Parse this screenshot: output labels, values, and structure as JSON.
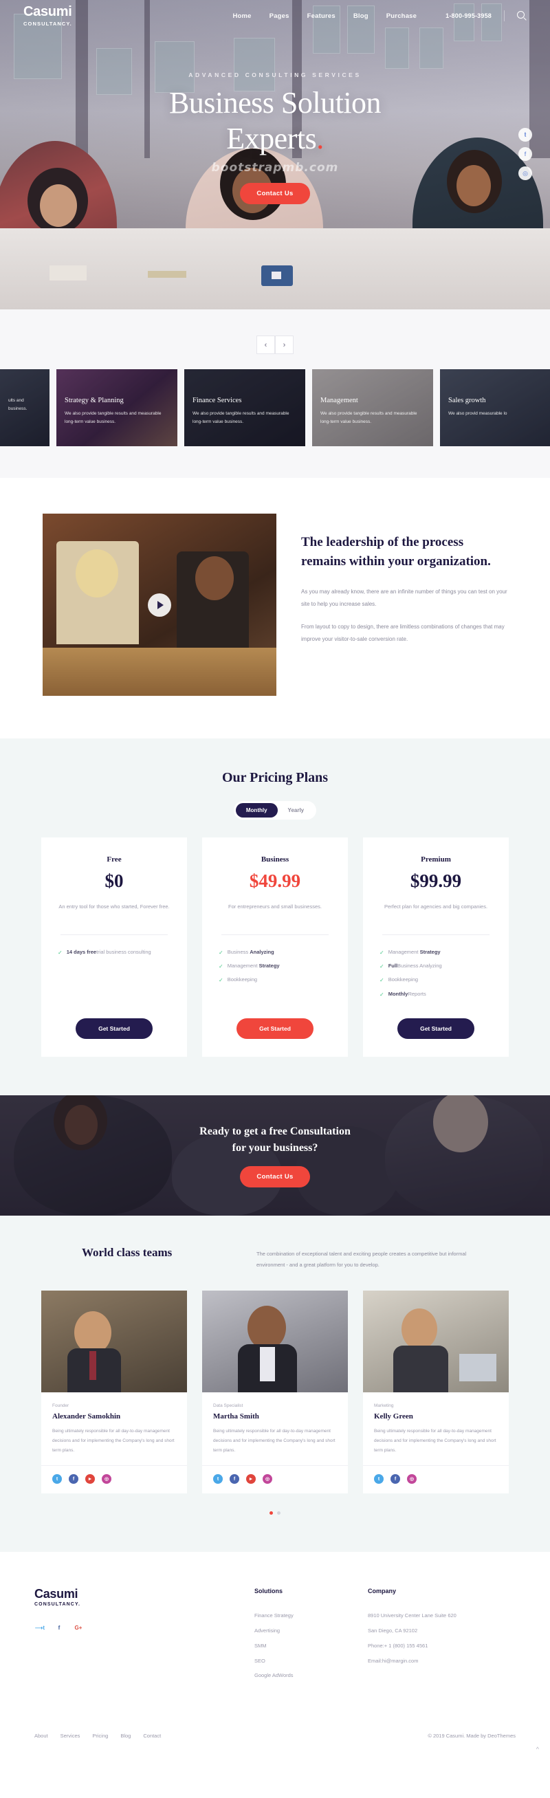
{
  "header": {
    "logo": "Casumi",
    "logo_sub": "CONSULTANCY.",
    "nav": [
      {
        "label": "Home"
      },
      {
        "label": "Pages"
      },
      {
        "label": "Features"
      },
      {
        "label": "Blog"
      },
      {
        "label": "Purchase"
      }
    ],
    "phone": "1-800-995-3958",
    "search_icon": "search-icon"
  },
  "hero": {
    "eyebrow": "ADVANCED CONSULTING SERVICES",
    "title_line1": "Business Solution",
    "title_line2": "Experts",
    "title_dot": ".",
    "watermark": "bootstrapmb.com",
    "cta": "Contact Us",
    "side_dots": [
      "●",
      "●",
      "●"
    ]
  },
  "services": {
    "prev_icon": "chevron-left-icon",
    "next_icon": "chevron-right-icon",
    "cards": [
      {
        "title": "",
        "text": "ults and\nbusiness."
      },
      {
        "title": "Strategy & Planning",
        "text": "We also provide tangible results and measurable long-term value business."
      },
      {
        "title": "Finance Services",
        "text": "We also provide tangible results and measurable long-term value business."
      },
      {
        "title": "Management",
        "text": "We also provide tangible results and measurable long-term value business."
      },
      {
        "title": "Sales growth",
        "text": "We also provid measurable lo"
      }
    ]
  },
  "leadership": {
    "play_icon": "play-icon",
    "heading": "The leadership of the process remains within your organization.",
    "para1": "As you may already know, there are an infinite number of things you can test on your site to help you increase sales.",
    "para2": "From layout to copy to design, there are limitless combinations of changes that may improve your visitor-to-sale conversion rate."
  },
  "pricing": {
    "heading": "Our Pricing Plans",
    "toggle_monthly": "Monthly",
    "toggle_yearly": "Yearly",
    "plans": [
      {
        "name": "Free",
        "price": "$0",
        "desc": "An entry tool for those who started, Forever free.",
        "features": [
          {
            "bold": "14 days free",
            "rest": "trial business consulting"
          }
        ],
        "button": "Get Started",
        "accent": "dark"
      },
      {
        "name": "Business",
        "price": "$49.99",
        "desc": "For entrepreneurs and small businesses.",
        "features": [
          {
            "bold": "",
            "rest": "Business ",
            "tail_bold": "Analyzing"
          },
          {
            "bold": "",
            "rest": "Management ",
            "tail_bold": "Strategy"
          },
          {
            "bold": "",
            "rest": "Bookkeeping",
            "tail_bold": ""
          }
        ],
        "button": "Get Started",
        "accent": "red"
      },
      {
        "name": "Premium",
        "price": "$99.99",
        "desc": "Perfect plan for agencies and big companies.",
        "features": [
          {
            "bold": "",
            "rest": "Management ",
            "tail_bold": "Strategy"
          },
          {
            "bold": "Full",
            "rest": "Business Analyzing",
            "tail_bold": ""
          },
          {
            "bold": "",
            "rest": "Bookkeeping",
            "tail_bold": ""
          },
          {
            "bold": "Monthly",
            "rest": "Reports",
            "tail_bold": ""
          }
        ],
        "button": "Get Started",
        "accent": "dark"
      }
    ]
  },
  "consultation": {
    "line1": "Ready to get a free Consultation",
    "line2": "for your business?",
    "cta": "Contact Us"
  },
  "team": {
    "heading": "World class teams",
    "intro": "The combination of exceptional talent and exciting people creates a competitive but informal environment - and a great platform for you to develop.",
    "members": [
      {
        "role": "Founder",
        "name": "Alexander Samokhin",
        "bio": "Being ultimately responsible for all day-to-day management decisions and for implementing the Company's long and short term plans.",
        "socials": [
          "twitter-icon",
          "facebook-icon",
          "youtube-icon",
          "instagram-icon"
        ]
      },
      {
        "role": "Data Specialist",
        "name": "Martha Smith",
        "bio": "Being ultimately responsible for all day-to-day management decisions and for implementing the Company's long and short term plans.",
        "socials": [
          "twitter-icon",
          "facebook-icon",
          "youtube-icon",
          "instagram-icon"
        ]
      },
      {
        "role": "Marketing",
        "name": "Kelly Green",
        "bio": "Being ultimately responsible for all day-to-day management decisions and for implementing the Company's long and short term plans.",
        "socials": [
          "twitter-icon",
          "facebook-icon",
          "instagram-icon"
        ]
      }
    ],
    "dots": 2
  },
  "footer": {
    "logo": "Casumi",
    "logo_sub": "CONSULTANCY.",
    "socials": [
      "twitter-icon",
      "facebook-icon",
      "google-plus-icon"
    ],
    "col_solutions": {
      "title": "Solutions",
      "items": [
        "Finance Strategy",
        "Advertising",
        "SMM",
        "SEO",
        "Google AdWords"
      ]
    },
    "col_company": {
      "title": "Company",
      "items": [
        "8910 University Center Lane Suite 620",
        "San Diego, CA 92102",
        "Phone:+ 1 (800) 155 4561",
        "Email:hi@margin.com"
      ]
    },
    "bottom_links": [
      "About",
      "Services",
      "Pricing",
      "Blog",
      "Contact"
    ],
    "copyright": "© 2019 Casumi. Made by DeoThemes",
    "to_top_icon": "chevron-up-icon"
  },
  "colors": {
    "accent_red": "#f0463c",
    "dark_navy": "#241c4f",
    "check_green": "#49c98a",
    "muted": "#9b9aab"
  }
}
